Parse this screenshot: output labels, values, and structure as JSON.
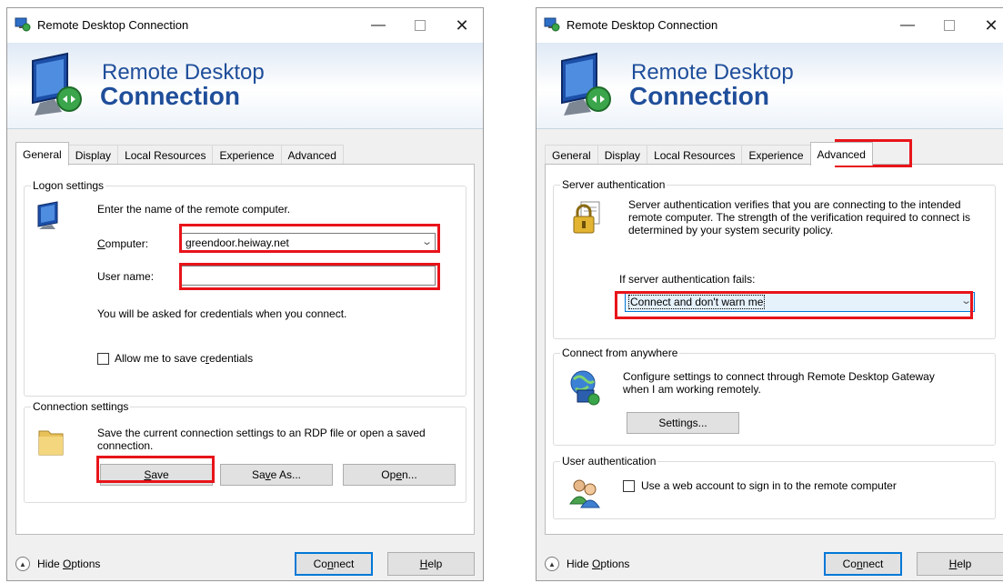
{
  "window_title": "Remote Desktop Connection",
  "banner": {
    "line1": "Remote Desktop",
    "line2": "Connection"
  },
  "title_buttons": {
    "minimize": "—",
    "close": "✕"
  },
  "tabs": [
    "General",
    "Display",
    "Local Resources",
    "Experience",
    "Advanced"
  ],
  "left": {
    "active_tab": "General",
    "logon_title": "Logon settings",
    "logon_intro": "Enter the name of the remote computer.",
    "computer_label_pre": "",
    "computer_label_ul": "C",
    "computer_label_post": "omputer:",
    "computer_value": "greendoor.heiway.net",
    "username_label": "User name:",
    "username_value": "",
    "credentials_note": "You will be asked for credentials when you connect.",
    "allow_save_pre": "Allow me to save c",
    "allow_save_ul": "r",
    "allow_save_post": "edentials",
    "allow_save_checked": false,
    "connection_title": "Connection settings",
    "connection_text": "Save the current connection settings to an RDP file or open a saved connection.",
    "save_ul": "S",
    "save_post": "ave",
    "saveas_pre": "Sa",
    "saveas_ul": "v",
    "saveas_post": "e As...",
    "open_pre": "Op",
    "open_ul": "e",
    "open_post": "n..."
  },
  "right": {
    "active_tab": "Advanced",
    "server_auth_title": "Server authentication",
    "server_auth_text": "Server authentication verifies that you are connecting to the intended remote computer. The strength of the verification required to connect is determined by your system security policy.",
    "if_fails_label": "If server authentication fails:",
    "if_fails_value": "Connect and don't warn me",
    "anywhere_title": "Connect from anywhere",
    "anywhere_text": "Configure settings to connect through Remote Desktop Gateway when I am working remotely.",
    "settings_button": "Settings...",
    "user_auth_title": "User authentication",
    "web_account_label": "Use a web account to sign in to the remote computer",
    "web_account_checked": false
  },
  "footer": {
    "hide_options_pre": "Hide ",
    "hide_options_ul": "O",
    "hide_options_post": "ptions",
    "connect_pre": "Co",
    "connect_ul": "n",
    "connect_post": "nect",
    "help_ul": "H",
    "help_post": "elp"
  },
  "colors": {
    "highlight": "#e8141a",
    "title_blue": "#1f4e9a",
    "default_button_border": "#0078d7"
  },
  "icons": [
    "rdc-app-icon",
    "monitor-connection-icon",
    "monitor-icon",
    "folder-icon",
    "padlock-certificate-icon",
    "gateway-globe-icon",
    "users-icon",
    "chevron-down-icon",
    "chevron-up-icon"
  ]
}
